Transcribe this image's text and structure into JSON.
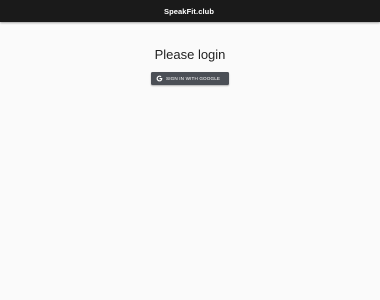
{
  "appbar": {
    "title": "SpeakFit.club"
  },
  "main": {
    "heading": "Please login",
    "signin_button": {
      "label": "SIGN IN WITH GOOGLE",
      "icon": "google-g-icon"
    }
  },
  "colors": {
    "appbar_bg": "#1a1a1a",
    "page_bg": "#fafafa",
    "button_bg": "#4b4f56",
    "button_text": "#ffffff"
  }
}
